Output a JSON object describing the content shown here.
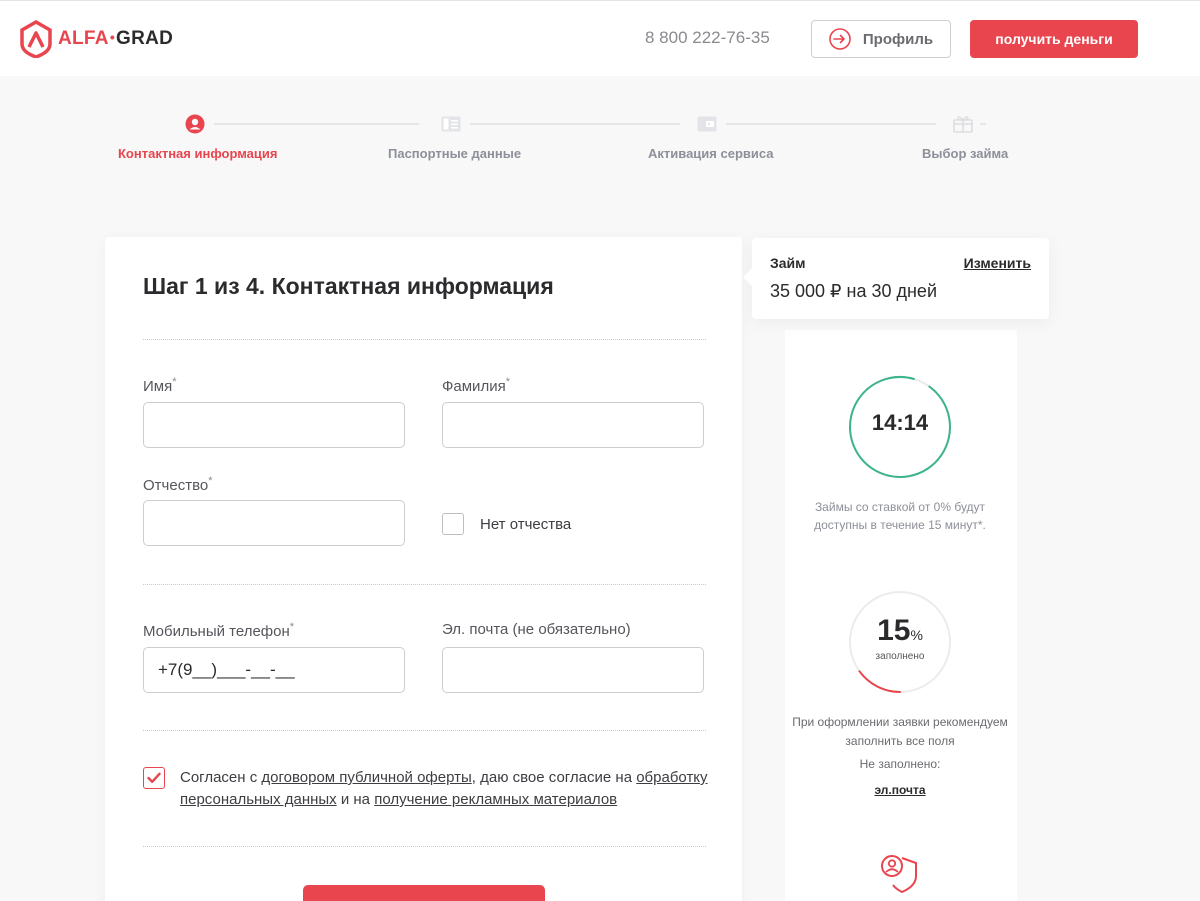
{
  "header": {
    "logo": {
      "part1": "ALFA",
      "dot": "•",
      "part2": "GRAD"
    },
    "phone": "8 800 222-76-35",
    "profile_label": "Профиль",
    "cta_label": "получить деньги"
  },
  "colors": {
    "accent": "#e8454e",
    "timer": "#3cb48c",
    "muted": "#8d8f99"
  },
  "steps": [
    {
      "label": "Контактная информация",
      "icon": "user-icon",
      "active": true
    },
    {
      "label": "Паспортные данные",
      "icon": "passport-icon",
      "active": false
    },
    {
      "label": "Активация сервиса",
      "icon": "wallet-icon",
      "active": false
    },
    {
      "label": "Выбор займа",
      "icon": "gift-icon",
      "active": false
    }
  ],
  "form": {
    "title": "Шаг 1 из 4. Контактная информация",
    "required_mark": "*",
    "first_name": {
      "label": "Имя",
      "value": ""
    },
    "last_name": {
      "label": "Фамилия",
      "value": ""
    },
    "patronymic": {
      "label": "Отчество",
      "value": ""
    },
    "no_patronymic": {
      "label": "Нет отчества",
      "checked": false
    },
    "phone": {
      "label": "Мобильный телефон",
      "value": "+7(9__)___-__-__"
    },
    "email": {
      "label": "Эл. почта (не обязательно)",
      "value": ""
    },
    "agreement": {
      "checked": true,
      "text1": "Согласен с ",
      "link1": "договором публичной оферты",
      "text2": ", даю свое согласие на ",
      "link2": "обработку персональных данных",
      "text3": " и на ",
      "link3": "получение рекламных материалов"
    }
  },
  "loan": {
    "title": "Займ",
    "change_label": "Изменить",
    "value": "35 000 ₽ на 30 дней"
  },
  "timer": {
    "value": "14:14",
    "note": "Займы со ставкой от 0% будут доступны в течение 15 минут*."
  },
  "progress": {
    "value": "15",
    "unit": "%",
    "fraction": 0.15,
    "caption": "заполнено",
    "note": "При оформлении заявки рекомендуем заполнить все поля",
    "not_filled_label": "Не заполнено:",
    "missing_field": "эл.почта"
  }
}
